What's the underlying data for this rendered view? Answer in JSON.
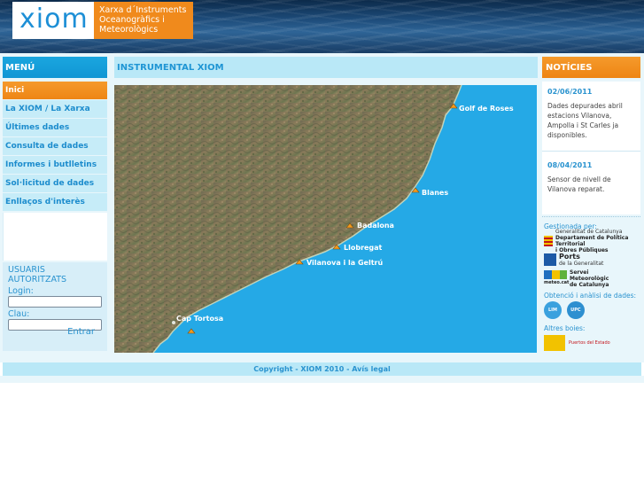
{
  "header": {
    "logo_text": "xiom",
    "tagline": [
      "Xarxa d´Instruments",
      "Oceanogràfics i",
      "Meteorològics"
    ]
  },
  "menu": {
    "title": "MENÚ",
    "items": [
      {
        "label": "Inici",
        "active": true
      },
      {
        "label": "La XIOM / La Xarxa",
        "active": false
      },
      {
        "label": "Últimes dades",
        "active": false
      },
      {
        "label": "Consulta de dades",
        "active": false
      },
      {
        "label": "Informes i butlletins",
        "active": false
      },
      {
        "label": "Sol·licitud de dades",
        "active": false
      },
      {
        "label": "Enllaços d'interès",
        "active": false
      }
    ]
  },
  "login": {
    "title": "USUARIS AUTORITZATS",
    "login_label": "Login:",
    "password_label": "Clau:",
    "submit_label": "Entrar"
  },
  "main": {
    "title": "INSTRUMENTAL XIOM",
    "stations": [
      "Golf de Roses",
      "Blanes",
      "Badalona",
      "Llobregat",
      "Vilanova i la Geltrú",
      "Cap Tortosa"
    ]
  },
  "news": {
    "title": "NOTÍCIES",
    "items": [
      {
        "date": "02/06/2011",
        "text": "Dades depurades abril estacions Vilanova, Ampolla i St Carles ja disponibles."
      },
      {
        "date": "08/04/2011",
        "text": "Sensor de nivell de Vilanova reparat."
      }
    ]
  },
  "side": {
    "managed_by": "Gestionada per:",
    "orgs": [
      {
        "line1": "Generalitat de Catalunya",
        "line2": "Departament de Política Territorial",
        "line3": "i Obres Públiques"
      },
      {
        "line1": "Ports",
        "line2": "de la Generalitat",
        "line3": ""
      },
      {
        "line1": "Servei",
        "line2": "Meteorològic",
        "line3": "de Catalunya"
      }
    ],
    "meteo_label": "meteo.cat",
    "data_label": "Obtenció i anàlisi de dades:",
    "lim_label": "LIM",
    "upc_label": "UPC",
    "other_buoys": "Altres boies:",
    "puertos_label": "Puertos del Estado"
  },
  "footer": {
    "text": "Copyright - XIOM 2010 - Avís legal"
  },
  "colors": {
    "accent_blue": "#1196d4",
    "accent_orange": "#ee8514",
    "light_blue": "#b9e8f7",
    "sea": "#25a9e6"
  }
}
